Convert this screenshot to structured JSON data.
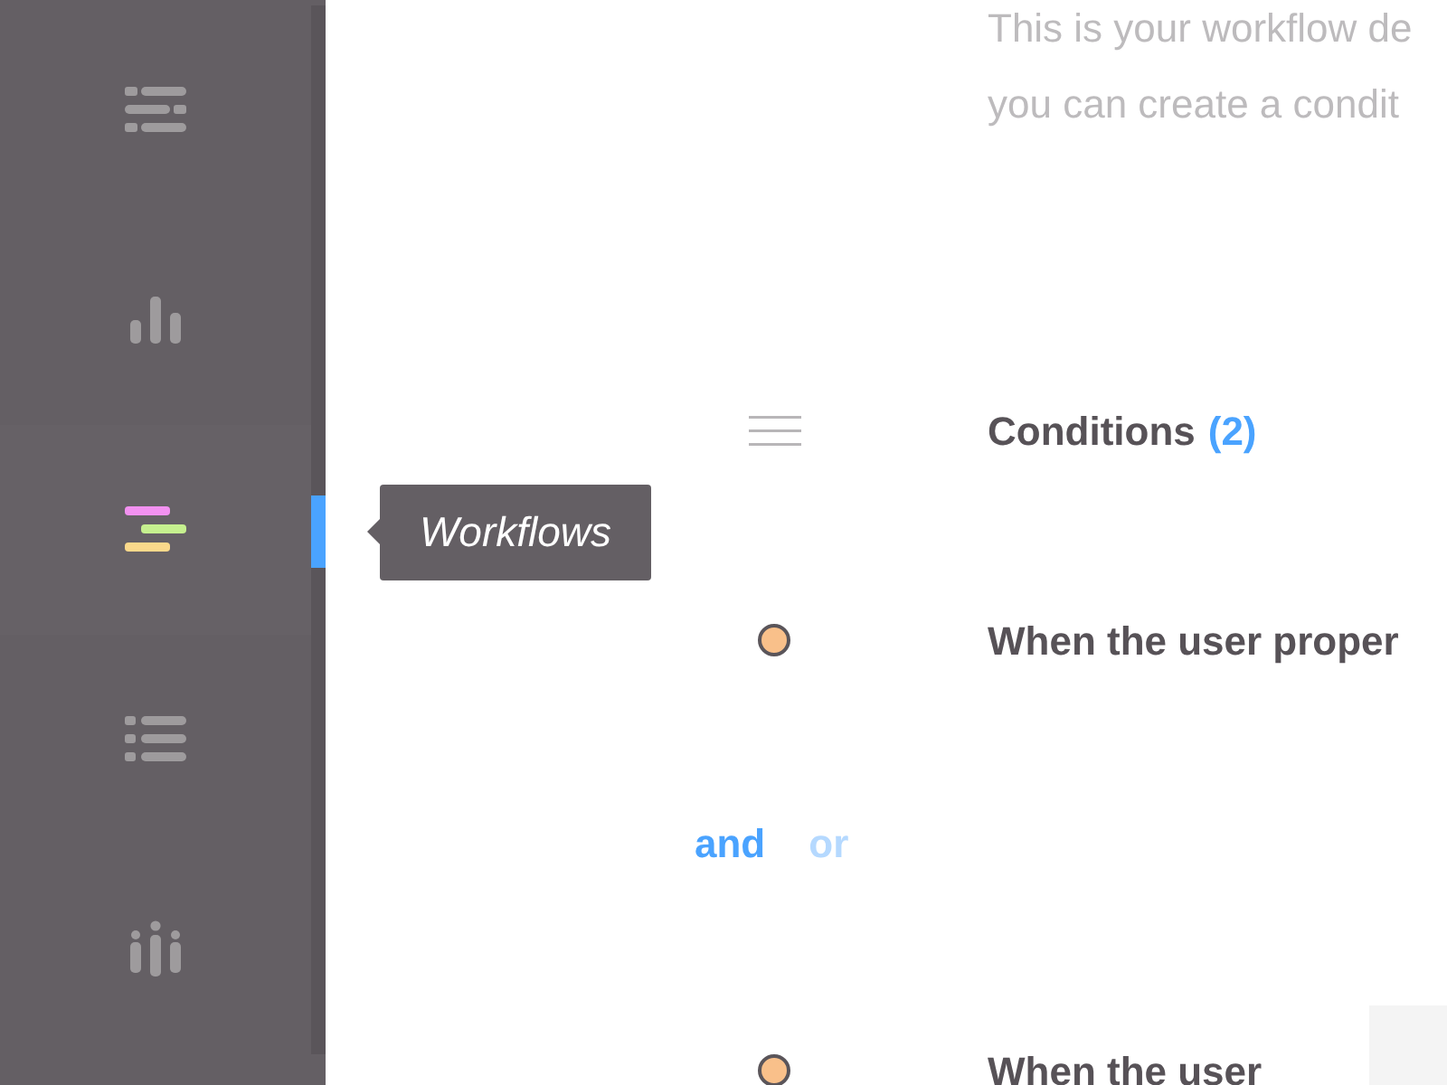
{
  "sidebar": {
    "items": [
      {
        "selected": false
      },
      {
        "selected": false
      },
      {
        "selected": true
      },
      {
        "selected": false
      },
      {
        "selected": false
      }
    ]
  },
  "tooltip": {
    "text": "Workflows"
  },
  "description": [
    "This is your workflow de",
    "you can create a condit"
  ],
  "conditions_header": {
    "title": "Conditions",
    "count": "(2)"
  },
  "conditions": [
    {
      "text": "When the user proper",
      "color": "#f9c08a",
      "has_value_field": false
    },
    {
      "text": "When the user",
      "color": "#f9c08a",
      "has_value_field": true
    }
  ],
  "operators": [
    {
      "label": "and",
      "selected": true
    },
    {
      "label": "or",
      "selected": false
    }
  ]
}
